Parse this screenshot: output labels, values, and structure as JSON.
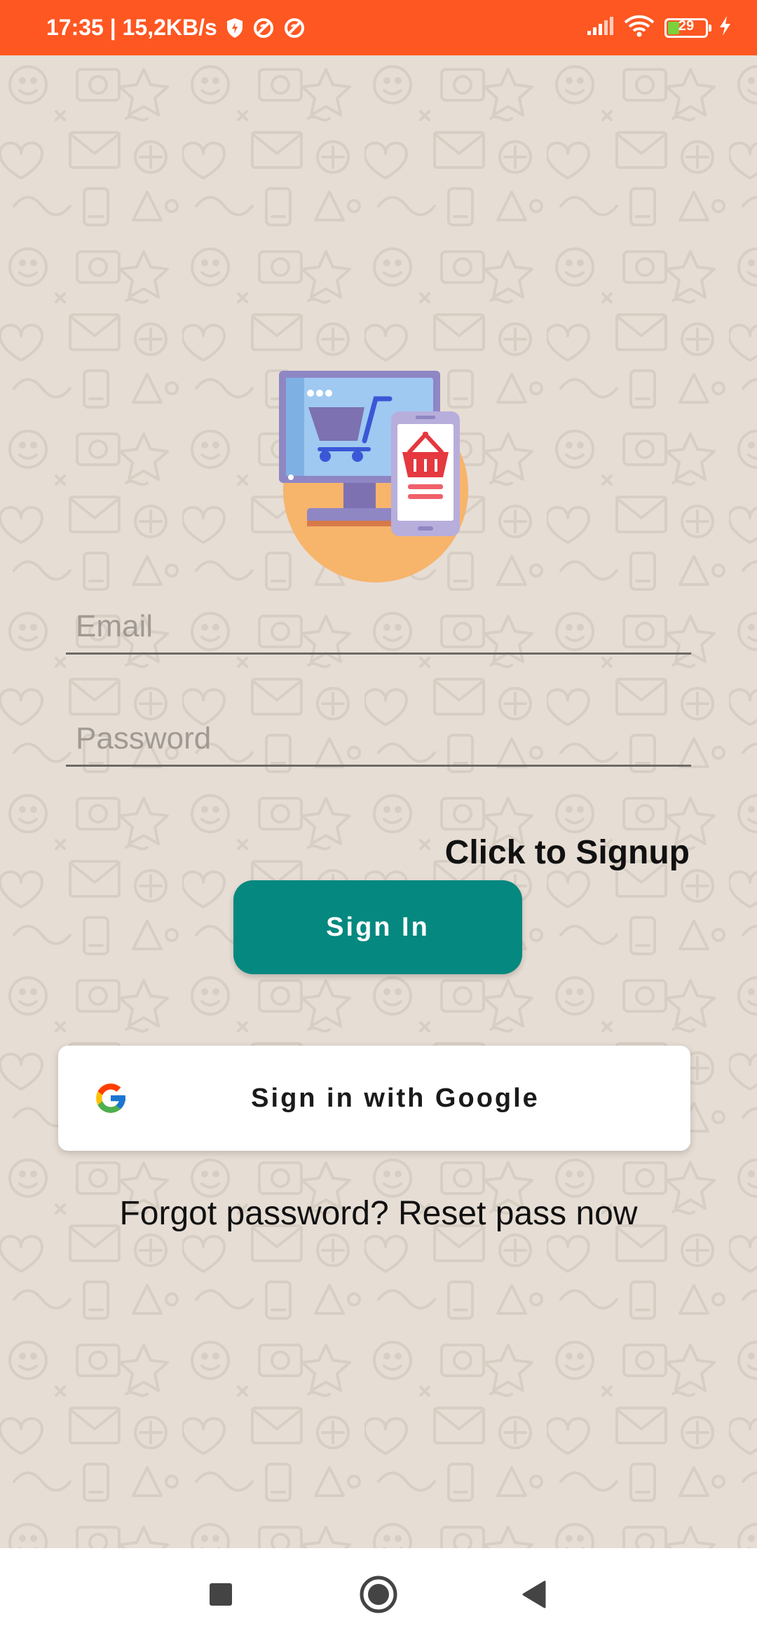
{
  "status_bar": {
    "time_speed": "17:35 | 15,2KB/s",
    "battery_level": "29",
    "battery_fraction": 0.29,
    "icons": [
      "shield-icon",
      "blocked-icon",
      "blocked-icon",
      "signal-icon",
      "wifi-icon",
      "battery-icon",
      "charging-icon"
    ],
    "color": "#fe5722"
  },
  "login": {
    "email_placeholder": "Email",
    "password_placeholder": "Password",
    "signup_link": "Click to Signup",
    "signin_button": "Sign In",
    "google_button": "Sign in with Google",
    "forgot_link": "Forgot password? Reset pass now"
  },
  "colors": {
    "background": "#e6ddd4",
    "signin_button": "#05887f",
    "status_bar": "#fe5722"
  },
  "nav_bar": {
    "buttons": [
      "recents-square-icon",
      "home-circle-icon",
      "back-triangle-icon"
    ]
  }
}
